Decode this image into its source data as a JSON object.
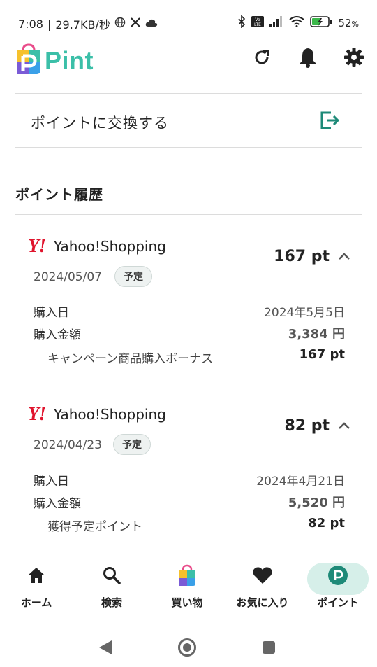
{
  "status_bar": {
    "time": "7:08",
    "network_speed": "29.7KB/秒",
    "battery": "52",
    "battery_unit": "%"
  },
  "header": {
    "logo_text": "Pint",
    "brand_color": "#3bbfa8"
  },
  "exchange": {
    "label": "ポイントに交換する"
  },
  "history": {
    "title": "ポイント履歴",
    "entries": [
      {
        "merchant_logo": "Y!",
        "merchant": "Yahoo!Shopping",
        "points": "167 pt",
        "date": "2024/05/07",
        "badge": "予定",
        "purchase_date_label": "購入日",
        "purchase_date": "2024年5月5日",
        "purchase_amount_label": "購入金額",
        "purchase_amount": "3,384 円",
        "detail_label": "キャンペーン商品購入ボーナス",
        "detail_value": "167 pt"
      },
      {
        "merchant_logo": "Y!",
        "merchant": "Yahoo!Shopping",
        "points": "82 pt",
        "date": "2024/04/23",
        "badge": "予定",
        "purchase_date_label": "購入日",
        "purchase_date": "2024年4月21日",
        "purchase_amount_label": "購入金額",
        "purchase_amount": "5,520 円",
        "detail_label": "獲得予定ポイント",
        "detail_value": "82 pt"
      }
    ]
  },
  "bottom_nav": {
    "items": [
      {
        "label": "ホーム",
        "icon": "home-icon"
      },
      {
        "label": "検索",
        "icon": "search-icon"
      },
      {
        "label": "買い物",
        "icon": "shopping-bag-icon"
      },
      {
        "label": "お気に入り",
        "icon": "heart-icon"
      },
      {
        "label": "ポイント",
        "icon": "points-icon"
      }
    ],
    "active": "ポイント",
    "active_color": "#d6efe9"
  },
  "colors": {
    "accent": "#1e8a78",
    "yahoo_red": "#e0142d"
  }
}
